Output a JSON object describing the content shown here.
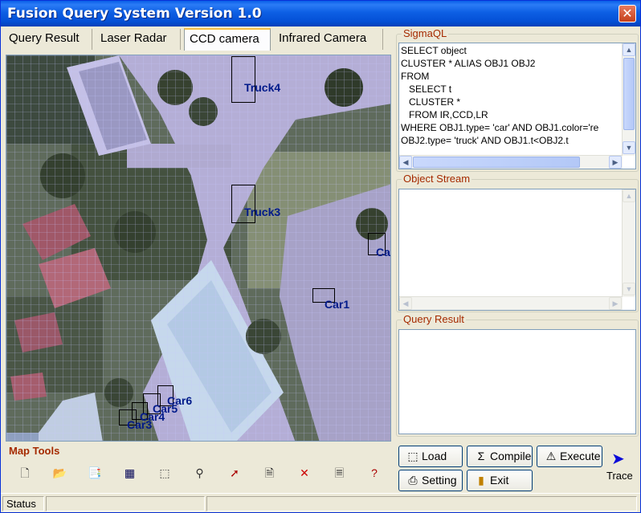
{
  "window": {
    "title": "Fusion Query System Version 1.0"
  },
  "tabs": [
    {
      "label": "Query Result",
      "active": false
    },
    {
      "label": "Laser Radar",
      "active": false
    },
    {
      "label": "CCD camera",
      "active": true
    },
    {
      "label": "Infrared Camera",
      "active": false
    }
  ],
  "map": {
    "objects": [
      {
        "label": "Truck4"
      },
      {
        "label": "Truck3"
      },
      {
        "label": "Ca"
      },
      {
        "label": "Car1"
      },
      {
        "label": "Car6"
      },
      {
        "label": "Car5"
      },
      {
        "label": "Car4"
      },
      {
        "label": "Car3"
      }
    ]
  },
  "sigmaql": {
    "label": "SigmaQL",
    "lines": [
      "SELECT object",
      "CLUSTER * ALIAS OBJ1 OBJ2",
      "FROM",
      "   SELECT t",
      "   CLUSTER *",
      "   FROM IR,CCD,LR",
      "WHERE OBJ1.type= 'car' AND OBJ1.color='re",
      "OBJ2.type= 'truck' AND OBJ1.t<OBJ2.t"
    ]
  },
  "object_stream": {
    "label": "Object Stream"
  },
  "query_result": {
    "label": "Query Result"
  },
  "map_tools": {
    "label": "Map Tools",
    "tools": [
      {
        "icon": "new-file-icon",
        "glyph": "🗋"
      },
      {
        "icon": "open-folder-icon",
        "glyph": "📂"
      },
      {
        "icon": "export-icon",
        "glyph": "📑"
      },
      {
        "icon": "table-icon",
        "glyph": "▦"
      },
      {
        "icon": "select-region-icon",
        "glyph": "⬚"
      },
      {
        "icon": "identify-icon",
        "glyph": "⚲"
      },
      {
        "icon": "pointer-icon",
        "glyph": "➚"
      },
      {
        "icon": "properties-icon",
        "glyph": "🗎"
      },
      {
        "icon": "delete-icon",
        "glyph": "✕"
      },
      {
        "icon": "document-icon",
        "glyph": "🗏"
      },
      {
        "icon": "help-icon",
        "glyph": "?"
      }
    ]
  },
  "buttons": {
    "load": "Load",
    "compile": "Compile",
    "execute": "Execute",
    "setting": "Setting",
    "exit": "Exit",
    "trace": "Trace"
  },
  "status": {
    "text": "Status"
  },
  "colors": {
    "titlebar": "#0a5ee8",
    "group_label": "#a52a00",
    "object_label": "#001a8a",
    "grid": "#c8c8ff"
  }
}
